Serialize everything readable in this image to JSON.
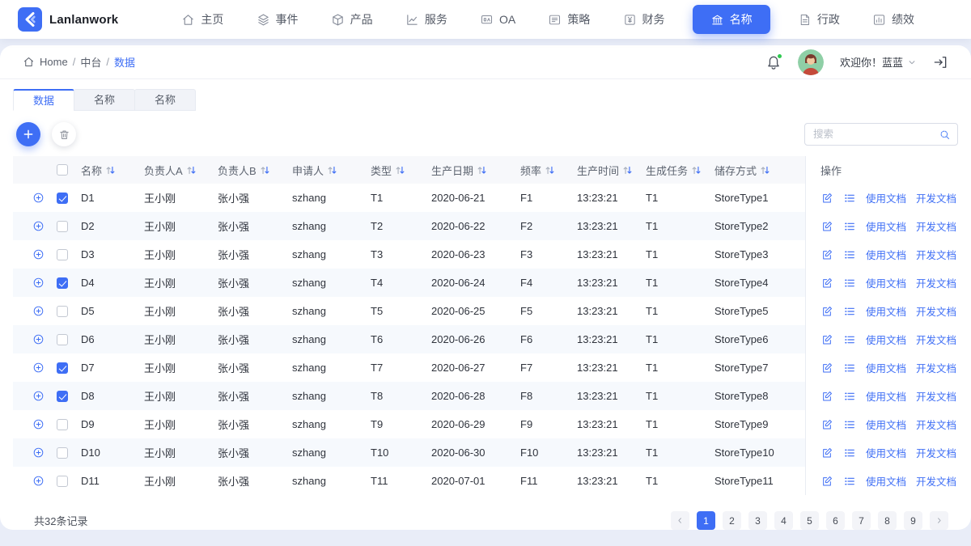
{
  "colors": {
    "primary": "#3e6ef5",
    "page_bg": "#e9edf8",
    "stripe": "#f6f9fd"
  },
  "brand": {
    "name": "Lanlanwork",
    "logo_icon": "brand-chevrons-icon"
  },
  "nav": {
    "items": [
      {
        "label": "主页",
        "icon": "home-icon",
        "active": false
      },
      {
        "label": "事件",
        "icon": "layers-icon",
        "active": false
      },
      {
        "label": "产品",
        "icon": "box-icon",
        "active": false
      },
      {
        "label": "服务",
        "icon": "line-chart-icon",
        "active": false
      },
      {
        "label": "OA",
        "icon": "oa-screen-icon",
        "active": false
      },
      {
        "label": "策略",
        "icon": "list-doc-icon",
        "active": false
      },
      {
        "label": "财务",
        "icon": "yen-icon",
        "active": false
      },
      {
        "label": "名称",
        "icon": "bank-icon",
        "active": true
      },
      {
        "label": "行政",
        "icon": "file-icon",
        "active": false
      },
      {
        "label": "绩效",
        "icon": "bar-chart-icon",
        "active": false
      }
    ]
  },
  "header": {
    "breadcrumb": {
      "icon": "home-icon",
      "separator": "/",
      "items": [
        {
          "label": "Home",
          "current": false
        },
        {
          "label": "中台",
          "current": false
        },
        {
          "label": "数据",
          "current": true
        }
      ]
    },
    "notification": {
      "icon": "bell-icon",
      "has_unread": true
    },
    "user": {
      "welcome": "欢迎你！蓝蓝",
      "avatar": "avatar-woman",
      "caret": "chevron-down-icon"
    },
    "logout_icon": "logout-icon"
  },
  "tabs": [
    {
      "label": "数据",
      "active": true
    },
    {
      "label": "名称",
      "active": false
    },
    {
      "label": "名称",
      "active": false
    }
  ],
  "toolbar": {
    "add_icon": "plus-icon",
    "delete_icon": "trash-icon",
    "search": {
      "placeholder": "搜索",
      "icon": "search-icon"
    }
  },
  "table": {
    "columns": [
      {
        "key": "name",
        "label": "名称",
        "sortable": true
      },
      {
        "key": "owner_a",
        "label": "负责人A",
        "sortable": true
      },
      {
        "key": "owner_b",
        "label": "负责人B",
        "sortable": true
      },
      {
        "key": "applicant",
        "label": "申请人",
        "sortable": true
      },
      {
        "key": "type",
        "label": "类型",
        "sortable": true
      },
      {
        "key": "prod_date",
        "label": "生产日期",
        "sortable": true
      },
      {
        "key": "freq",
        "label": "频率",
        "sortable": true
      },
      {
        "key": "prod_time",
        "label": "生产时间",
        "sortable": true
      },
      {
        "key": "task",
        "label": "生成任务",
        "sortable": true
      },
      {
        "key": "store",
        "label": "储存方式",
        "sortable": true
      },
      {
        "key": "ops",
        "label": "操作",
        "sortable": false
      }
    ],
    "actions": {
      "edit_icon": "edit-icon",
      "detail_icon": "list-detail-icon",
      "links": [
        "使用文档",
        "开发文档"
      ]
    },
    "rows": [
      {
        "checked": true,
        "name": "D1",
        "owner_a": "王小刚",
        "owner_b": "张小强",
        "applicant": "szhang",
        "type": "T1",
        "prod_date": "2020-06-21",
        "freq": "F1",
        "prod_time": "13:23:21",
        "task": "T1",
        "store": "StoreType1"
      },
      {
        "checked": false,
        "name": "D2",
        "owner_a": "王小刚",
        "owner_b": "张小强",
        "applicant": "szhang",
        "type": "T2",
        "prod_date": "2020-06-22",
        "freq": "F2",
        "prod_time": "13:23:21",
        "task": "T1",
        "store": "StoreType2"
      },
      {
        "checked": false,
        "name": "D3",
        "owner_a": "王小刚",
        "owner_b": "张小强",
        "applicant": "szhang",
        "type": "T3",
        "prod_date": "2020-06-23",
        "freq": "F3",
        "prod_time": "13:23:21",
        "task": "T1",
        "store": "StoreType3"
      },
      {
        "checked": true,
        "name": "D4",
        "owner_a": "王小刚",
        "owner_b": "张小强",
        "applicant": "szhang",
        "type": "T4",
        "prod_date": "2020-06-24",
        "freq": "F4",
        "prod_time": "13:23:21",
        "task": "T1",
        "store": "StoreType4"
      },
      {
        "checked": false,
        "name": "D5",
        "owner_a": "王小刚",
        "owner_b": "张小强",
        "applicant": "szhang",
        "type": "T5",
        "prod_date": "2020-06-25",
        "freq": "F5",
        "prod_time": "13:23:21",
        "task": "T1",
        "store": "StoreType5"
      },
      {
        "checked": false,
        "name": "D6",
        "owner_a": "王小刚",
        "owner_b": "张小强",
        "applicant": "szhang",
        "type": "T6",
        "prod_date": "2020-06-26",
        "freq": "F6",
        "prod_time": "13:23:21",
        "task": "T1",
        "store": "StoreType6"
      },
      {
        "checked": true,
        "name": "D7",
        "owner_a": "王小刚",
        "owner_b": "张小强",
        "applicant": "szhang",
        "type": "T7",
        "prod_date": "2020-06-27",
        "freq": "F7",
        "prod_time": "13:23:21",
        "task": "T1",
        "store": "StoreType7"
      },
      {
        "checked": true,
        "name": "D8",
        "owner_a": "王小刚",
        "owner_b": "张小强",
        "applicant": "szhang",
        "type": "T8",
        "prod_date": "2020-06-28",
        "freq": "F8",
        "prod_time": "13:23:21",
        "task": "T1",
        "store": "StoreType8"
      },
      {
        "checked": false,
        "name": "D9",
        "owner_a": "王小刚",
        "owner_b": "张小强",
        "applicant": "szhang",
        "type": "T9",
        "prod_date": "2020-06-29",
        "freq": "F9",
        "prod_time": "13:23:21",
        "task": "T1",
        "store": "StoreType9"
      },
      {
        "checked": false,
        "name": "D10",
        "owner_a": "王小刚",
        "owner_b": "张小强",
        "applicant": "szhang",
        "type": "T10",
        "prod_date": "2020-06-30",
        "freq": "F10",
        "prod_time": "13:23:21",
        "task": "T1",
        "store": "StoreType10"
      },
      {
        "checked": false,
        "name": "D11",
        "owner_a": "王小刚",
        "owner_b": "张小强",
        "applicant": "szhang",
        "type": "T11",
        "prod_date": "2020-07-01",
        "freq": "F11",
        "prod_time": "13:23:21",
        "task": "T1",
        "store": "StoreType11"
      }
    ]
  },
  "footer": {
    "total": "共32条记录",
    "pagination": {
      "prev_icon": "chevron-left-icon",
      "next_icon": "chevron-right-icon",
      "pages": [
        "1",
        "2",
        "3",
        "4",
        "5",
        "6",
        "7",
        "8",
        "9"
      ],
      "current": "1"
    }
  }
}
